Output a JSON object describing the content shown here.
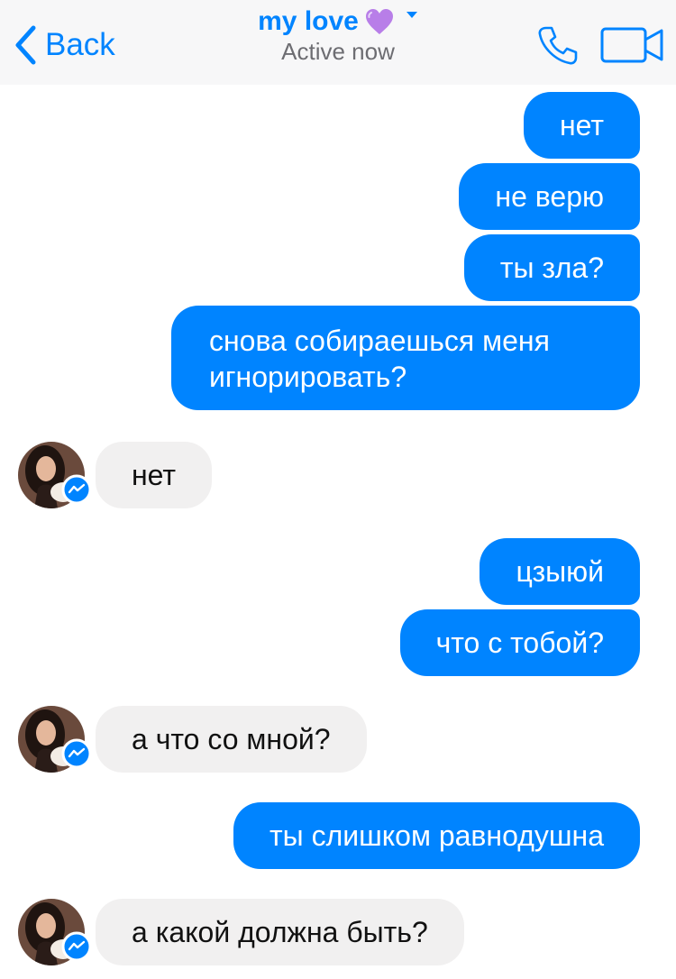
{
  "header": {
    "back_label": "Back",
    "contact_name": "my love",
    "status": "Active now",
    "accent_color": "#0084ff",
    "icons": [
      "chevron-left-icon",
      "purple-heart-icon",
      "caret-down-icon",
      "phone-icon",
      "video-camera-icon"
    ]
  },
  "messages": [
    {
      "direction": "outgoing",
      "text": "нет"
    },
    {
      "direction": "outgoing",
      "text": "не верю"
    },
    {
      "direction": "outgoing",
      "text": "ты зла?"
    },
    {
      "direction": "outgoing",
      "text": "снова собираешься меня игнорировать?"
    },
    {
      "direction": "incoming",
      "text": "нет"
    },
    {
      "direction": "outgoing",
      "text": "цзыюй"
    },
    {
      "direction": "outgoing",
      "text": "что с тобой?"
    },
    {
      "direction": "incoming",
      "text": "а что со мной?"
    },
    {
      "direction": "outgoing",
      "text": "ты слишком равнодушна"
    },
    {
      "direction": "incoming",
      "text": "а какой должна быть?"
    }
  ],
  "colors": {
    "outgoing_bubble": "#0084ff",
    "incoming_bubble": "#f1f0f0",
    "header_background": "#f7f7f8",
    "status_text": "#6d6d72"
  }
}
